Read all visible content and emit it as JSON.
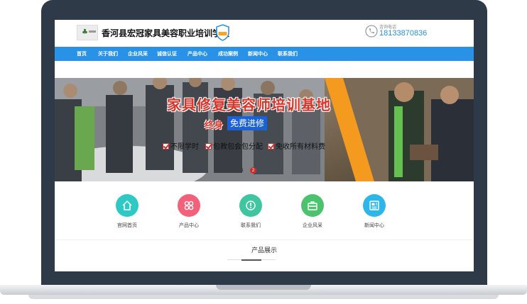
{
  "header": {
    "site_title": "香河县宏冠家具美容职业培训学校",
    "phone_label": "咨询电话",
    "phone_number": "18133870836"
  },
  "nav": {
    "items": [
      {
        "label": "首页"
      },
      {
        "label": "关于我们"
      },
      {
        "label": "企业风采"
      },
      {
        "label": "诚信认证"
      },
      {
        "label": "产品中心"
      },
      {
        "label": "成功案例"
      },
      {
        "label": "新闻中心"
      },
      {
        "label": "联系我们"
      }
    ]
  },
  "banner": {
    "headline": "家具修复美容师培训基地",
    "lifetime": "终身",
    "free_training": "免费进修",
    "features": [
      "不限学时",
      "包教包会包分配",
      "免收所有材料费"
    ],
    "dots": [
      "1",
      "2"
    ],
    "active_dot": 2
  },
  "quick_nav": [
    {
      "label": "官网首页",
      "color": "#2ec9c4",
      "icon": "home-icon"
    },
    {
      "label": "产品中心",
      "color": "#f2607a",
      "icon": "grid-icon"
    },
    {
      "label": "联系我们",
      "color": "#3fc6a0",
      "icon": "compass-icon"
    },
    {
      "label": "企业风采",
      "color": "#4cc26f",
      "icon": "briefcase-icon"
    },
    {
      "label": "新闻中心",
      "color": "#2fb6e8",
      "icon": "news-icon"
    }
  ],
  "section": {
    "title": "产品展示"
  },
  "colors": {
    "nav_bg": "#2a92e6",
    "phone_text": "#2a8fd8",
    "headline": "#d8352a",
    "free_box": "#1a61d8"
  }
}
